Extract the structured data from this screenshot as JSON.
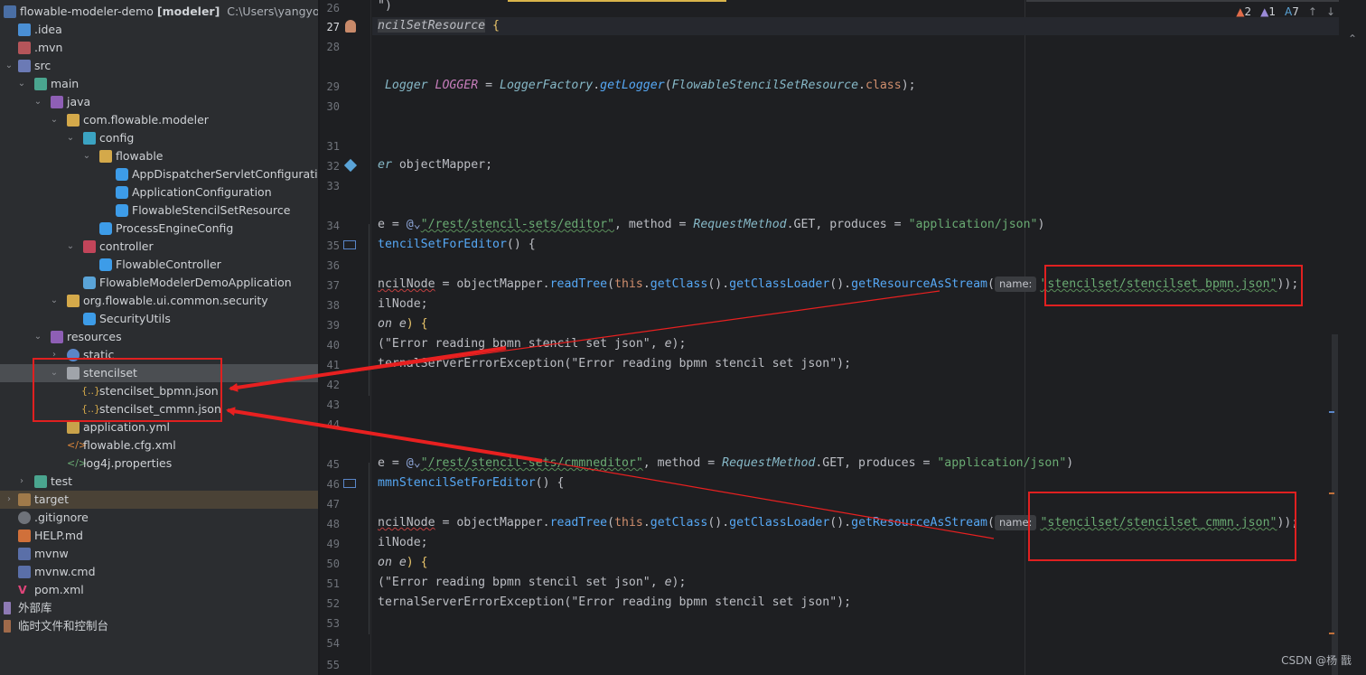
{
  "project": {
    "root_label": "flowable-modeler-demo",
    "root_module": "[modeler]",
    "root_path": "C:\\Users\\yangyongli",
    "items": [
      {
        "label": ".idea"
      },
      {
        "label": ".mvn"
      },
      {
        "label": "src"
      },
      {
        "label": "main"
      },
      {
        "label": "java"
      },
      {
        "label": "com.flowable.modeler"
      },
      {
        "label": "config"
      },
      {
        "label": "flowable"
      },
      {
        "label": "AppDispatcherServletConfiguration"
      },
      {
        "label": "ApplicationConfiguration"
      },
      {
        "label": "FlowableStencilSetResource"
      },
      {
        "label": "ProcessEngineConfig"
      },
      {
        "label": "controller"
      },
      {
        "label": "FlowableController"
      },
      {
        "label": "FlowableModelerDemoApplication"
      },
      {
        "label": "org.flowable.ui.common.security"
      },
      {
        "label": "SecurityUtils"
      },
      {
        "label": "resources"
      },
      {
        "label": "static"
      },
      {
        "label": "stencilset"
      },
      {
        "label": "stencilset_bpmn.json"
      },
      {
        "label": "stencilset_cmmn.json"
      },
      {
        "label": "application.yml"
      },
      {
        "label": "flowable.cfg.xml"
      },
      {
        "label": "log4j.properties"
      },
      {
        "label": "test"
      },
      {
        "label": "target"
      },
      {
        "label": ".gitignore"
      },
      {
        "label": "HELP.md"
      },
      {
        "label": "mvnw"
      },
      {
        "label": "mvnw.cmd"
      },
      {
        "label": "pom.xml"
      },
      {
        "label": "外部库"
      },
      {
        "label": "临时文件和控制台"
      }
    ]
  },
  "editor": {
    "line_numbers": [
      "26",
      "27",
      "28",
      "29",
      "30",
      "31",
      "32",
      "33",
      "34",
      "35",
      "36",
      "37",
      "38",
      "39",
      "40",
      "41",
      "42",
      "43",
      "44",
      "45",
      "46",
      "47",
      "48",
      "49",
      "50",
      "51",
      "52",
      "53",
      "54",
      "55"
    ],
    "code": {
      "l26": "\")",
      "l27a": "ncilSetResource",
      "l27b": " {",
      "l29a": "Logger ",
      "l29b": "LOGGER",
      "l29c": " = ",
      "l29d": "LoggerFactory",
      "l29e": ".",
      "l29f": "getLogger",
      "l29g": "(",
      "l29h": "FlowableStencilSetResource",
      "l29i": ".",
      "l29j": "class",
      "l29k": ");",
      "l32a": "er",
      "l32b": " objectMapper;",
      "l34a": "e = ",
      "l34b": "@⌄",
      "l34c": "\"/rest/stencil-sets/editor\"",
      "l34d": ", method = ",
      "l34e": "RequestMethod",
      "l34f": ".GET, produces = ",
      "l34g": "\"application/json\"",
      "l34h": ")",
      "l35a": "tencilSetForEditor",
      "l35b": "() {",
      "l37a": "ncilNode",
      "l37b": " = objectMapper.",
      "l37c": "readTree",
      "l37d": "(",
      "l37e": "this",
      "l37f": ".",
      "l37g": "getClass",
      "l37h": "().",
      "l37i": "getClassLoader",
      "l37j": "().",
      "l37k": "getResourceAsStream",
      "l37l": "(",
      "l37hint": "name:",
      "l37m": "\"stencilset/stencilset_bpmn.json\"",
      "l37n": "));",
      "l38": "ilNode;",
      "l39a": "on e",
      "l39b": ") {",
      "l40a": "(\"Error reading bpmn stencil set json\", ",
      "l40b": "e",
      "l40c": ");",
      "l41": "ternalServerErrorException(\"Error reading bpmn stencil set json\");",
      "l45a": "e = ",
      "l45b": "@⌄",
      "l45c": "\"/rest/stencil-sets/cmmneditor\"",
      "l45d": ", method = ",
      "l45e": "RequestMethod",
      "l45f": ".GET, produces = ",
      "l45g": "\"application/json\"",
      "l45h": ")",
      "l46a": "mmnStencilSetForEditor",
      "l46b": "() {",
      "l48a": "ncilNode",
      "l48b": " = objectMapper.",
      "l48c": "readTree",
      "l48d": "(",
      "l48e": "this",
      "l48f": ".",
      "l48g": "getClass",
      "l48h": "().",
      "l48i": "getClassLoader",
      "l48j": "().",
      "l48k": "getResourceAsStream",
      "l48l": "(",
      "l48hint": "name:",
      "l48m": "\"stencilset/stencilset_cmmn.json\"",
      "l48n": "));",
      "l49": "ilNode;",
      "l50a": "on e",
      "l50b": ") {",
      "l51a": "(\"Error reading bpmn stencil set json\", ",
      "l51b": "e",
      "l51c": ");",
      "l52": "ternalServerErrorException(\"Error reading bpmn stencil set json\");"
    }
  },
  "inspections": {
    "errors": "2",
    "warnings": "1",
    "typos": "7"
  },
  "watermark": "CSDN @杨 戬",
  "colors": {
    "annotation": "#e02020",
    "selection": "#4b4e52",
    "folder": "#d4a94a",
    "java_class": "#3d9ce8"
  }
}
